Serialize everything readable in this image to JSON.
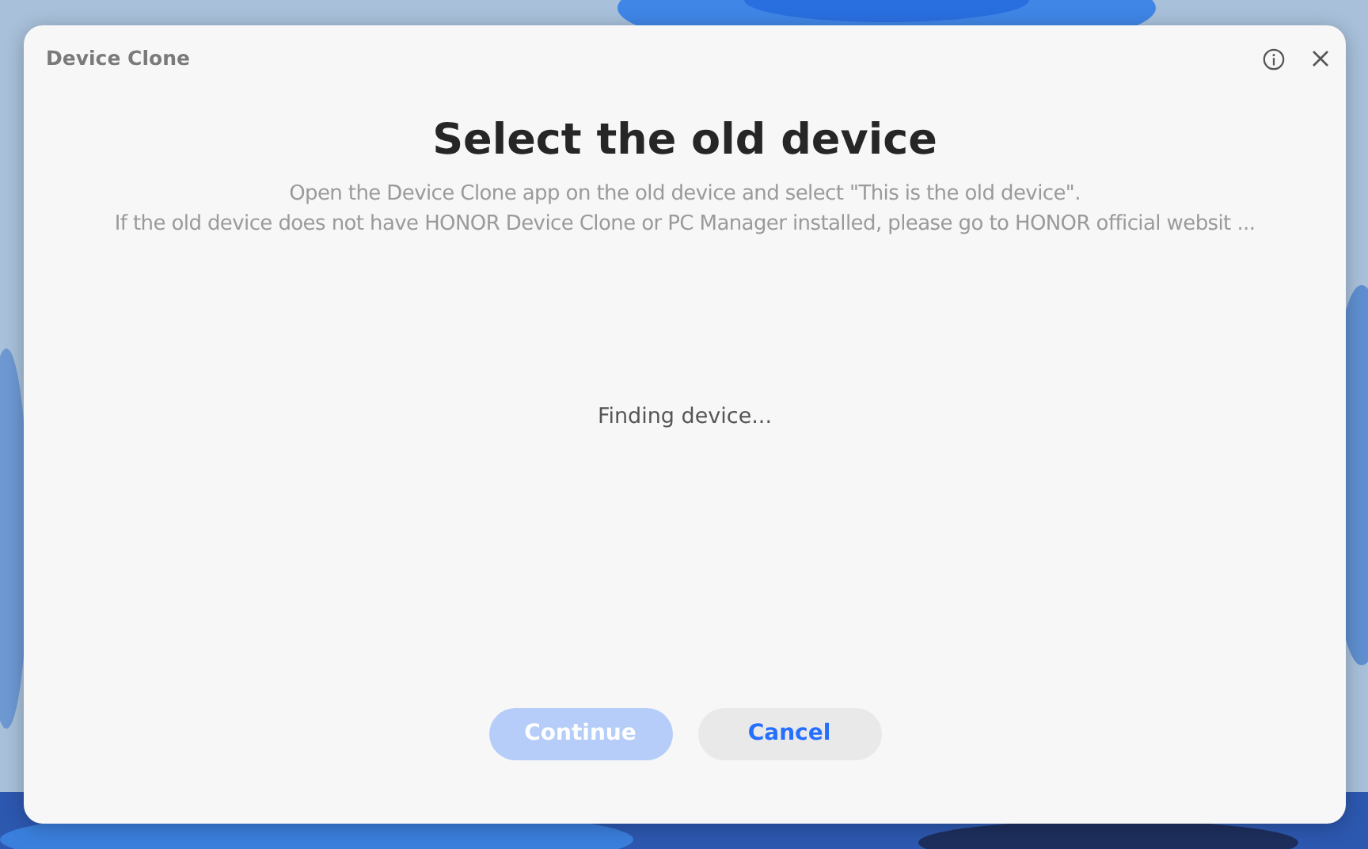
{
  "window": {
    "title": "Device Clone"
  },
  "heading": "Select the old device",
  "instructions": [
    "Open the Device Clone app on the old device and select \"This is the old device\".",
    "If the old device does not have HONOR Device Clone or PC Manager installed, please go to HONOR official websit ..."
  ],
  "status": "Finding device...",
  "buttons": [
    {
      "label": "Continue",
      "kind": "primary",
      "disabled": true
    },
    {
      "label": "Cancel",
      "kind": "secondary",
      "disabled": false
    }
  ]
}
